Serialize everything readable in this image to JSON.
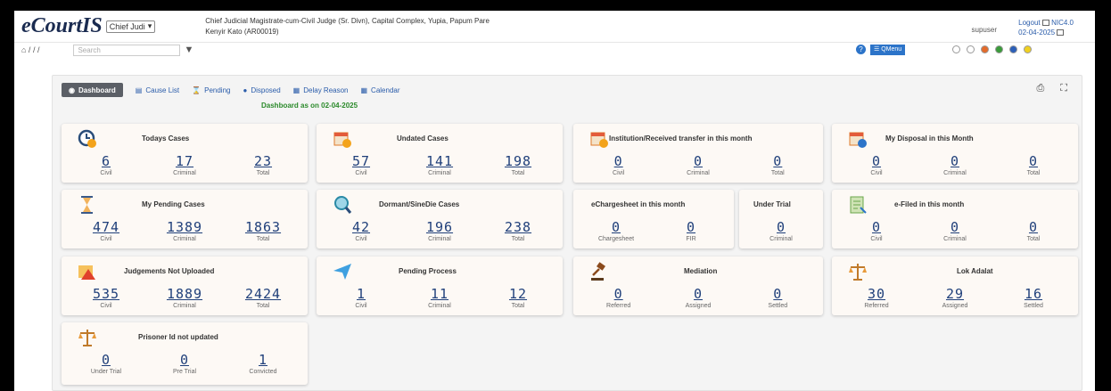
{
  "app": {
    "logo": "eCourtIS",
    "court_select": "Chief Judi"
  },
  "court_info": {
    "line1": "Chief Judicial Magistrate-cum-Civil Judge (Sr. Divn), Capital Complex, Yupia, Papum Pare",
    "line2": "Kenyir Kato (AR00019)"
  },
  "user": {
    "name": "supuser",
    "logout": "Logout",
    "version": "NIC4.0",
    "date": "02-04-2025"
  },
  "subbar": {
    "breadcrumb": "⌂ / / /",
    "search_placeholder": "Search",
    "qmenu": "☰ QMenu"
  },
  "tabs": [
    {
      "label": "Dashboard",
      "icon": "dashboard-icon"
    },
    {
      "label": "Cause List",
      "icon": "list-icon"
    },
    {
      "label": "Pending",
      "icon": "hourglass-icon"
    },
    {
      "label": "Disposed",
      "icon": "check-icon"
    },
    {
      "label": "Delay Reason",
      "icon": "calendar-icon"
    },
    {
      "label": "Calendar",
      "icon": "calendar-icon"
    }
  ],
  "dashboard_date": "Dashboard as on 02-04-2025",
  "cards": {
    "todays": {
      "title": "Todays Cases",
      "v": [
        "6",
        "17",
        "23"
      ],
      "l": [
        "Civil",
        "Criminal",
        "Total"
      ]
    },
    "undated": {
      "title": "Undated Cases",
      "v": [
        "57",
        "141",
        "198"
      ],
      "l": [
        "Civil",
        "Criminal",
        "Total"
      ]
    },
    "institution": {
      "title": "Institution/Received transfer in this month",
      "v": [
        "0",
        "0",
        "0"
      ],
      "l": [
        "Civil",
        "Criminal",
        "Total"
      ]
    },
    "mydisposal": {
      "title": "My Disposal in this Month",
      "v": [
        "0",
        "0",
        "0"
      ],
      "l": [
        "Civil",
        "Criminal",
        "Total"
      ]
    },
    "mypending": {
      "title": "My Pending Cases",
      "v": [
        "474",
        "1389",
        "1863"
      ],
      "l": [
        "Civil",
        "Criminal",
        "Total"
      ]
    },
    "dormant": {
      "title": "Dormant/SineDie Cases",
      "v": [
        "42",
        "196",
        "238"
      ],
      "l": [
        "Civil",
        "Criminal",
        "Total"
      ]
    },
    "echarge": {
      "title": "eChargesheet in this month",
      "v": [
        "0",
        "0"
      ],
      "l": [
        "Chargesheet",
        "FIR"
      ]
    },
    "undertrial": {
      "title": "Under Trial",
      "v": [
        "0"
      ],
      "l": [
        "Criminal"
      ]
    },
    "efiled": {
      "title": "e-Filed in this month",
      "v": [
        "0",
        "0",
        "0"
      ],
      "l": [
        "Civil",
        "Criminal",
        "Total"
      ]
    },
    "judgements": {
      "title": "Judgements Not Uploaded",
      "v": [
        "535",
        "1889",
        "2424"
      ],
      "l": [
        "Civil",
        "Criminal",
        "Total"
      ]
    },
    "process": {
      "title": "Pending Process",
      "v": [
        "1",
        "11",
        "12"
      ],
      "l": [
        "Civil",
        "Criminal",
        "Total"
      ]
    },
    "mediation": {
      "title": "Mediation",
      "v": [
        "0",
        "0",
        "0"
      ],
      "l": [
        "Referred",
        "Assigned",
        "Settled"
      ]
    },
    "lokadalat": {
      "title": "Lok Adalat",
      "v": [
        "30",
        "29",
        "16"
      ],
      "l": [
        "Referred",
        "Assigned",
        "Settled"
      ]
    },
    "prisoner": {
      "title": "Prisoner Id not updated",
      "v": [
        "0",
        "0",
        "1"
      ],
      "l": [
        "Under Trial",
        "Pre Trial",
        "Convicted"
      ]
    }
  }
}
